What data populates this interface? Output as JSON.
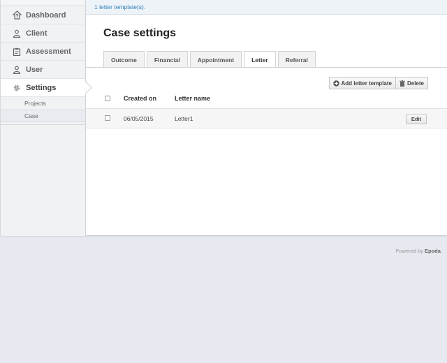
{
  "sidebar": {
    "items": [
      {
        "label": "Dashboard",
        "icon": "upload-home-icon"
      },
      {
        "label": "Client",
        "icon": "person-icon"
      },
      {
        "label": "Assessment",
        "icon": "clipboard-icon"
      },
      {
        "label": "User",
        "icon": "person-icon"
      },
      {
        "label": "Settings",
        "icon": "gear-icon"
      }
    ],
    "sub_items": [
      {
        "label": "Projects"
      },
      {
        "label": "Case"
      }
    ]
  },
  "main": {
    "info_message": "1 letter template(s).",
    "page_title": "Case settings",
    "tabs": [
      {
        "label": "Outcome"
      },
      {
        "label": "Financial"
      },
      {
        "label": "Appointment"
      },
      {
        "label": "Letter"
      },
      {
        "label": "Referral"
      }
    ],
    "toolbar": {
      "add_label": "Add letter template",
      "delete_label": "Delete"
    },
    "table": {
      "headers": {
        "created_on": "Created on",
        "letter_name": "Letter name"
      },
      "rows": [
        {
          "created_on": "06/05/2015",
          "letter_name": "Letter1",
          "edit_label": "Edit"
        }
      ]
    }
  },
  "footer": {
    "prefix": "Powered by",
    "brand": "Epoda",
    "suffix": "."
  },
  "colors": {
    "accent": "#2f7fb8",
    "page_background": "#e6e9f0"
  }
}
